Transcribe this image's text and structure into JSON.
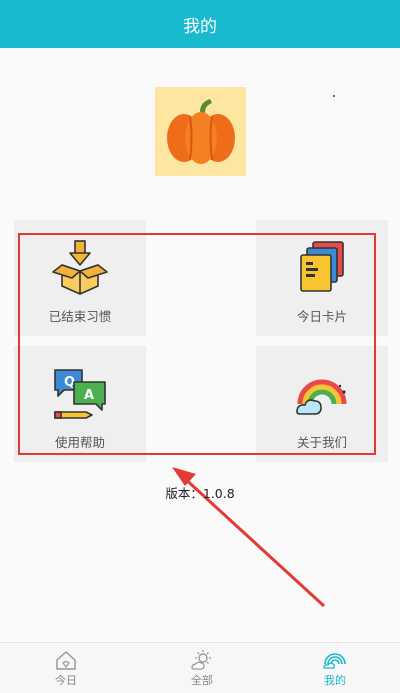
{
  "header": {
    "title": "我的"
  },
  "tiles": [
    {
      "label": "已结束习惯",
      "icon": "open-box-icon"
    },
    {
      "label": "今日卡片",
      "icon": "cards-icon"
    },
    {
      "label": "使用帮助",
      "icon": "qa-chat-icon"
    },
    {
      "label": "关于我们",
      "icon": "rainbow-cloud-icon"
    }
  ],
  "version": {
    "label": "版本：",
    "value": "1.0.8"
  },
  "nav": [
    {
      "label": "今日",
      "icon": "house-icon",
      "active": false
    },
    {
      "label": "全部",
      "icon": "sun-cloud-icon",
      "active": false
    },
    {
      "label": "我的",
      "icon": "rainbow-icon",
      "active": true
    }
  ],
  "colors": {
    "accent": "#19b9cf",
    "annotation": "#e53935",
    "avatar_bg": "#fde7a0"
  }
}
